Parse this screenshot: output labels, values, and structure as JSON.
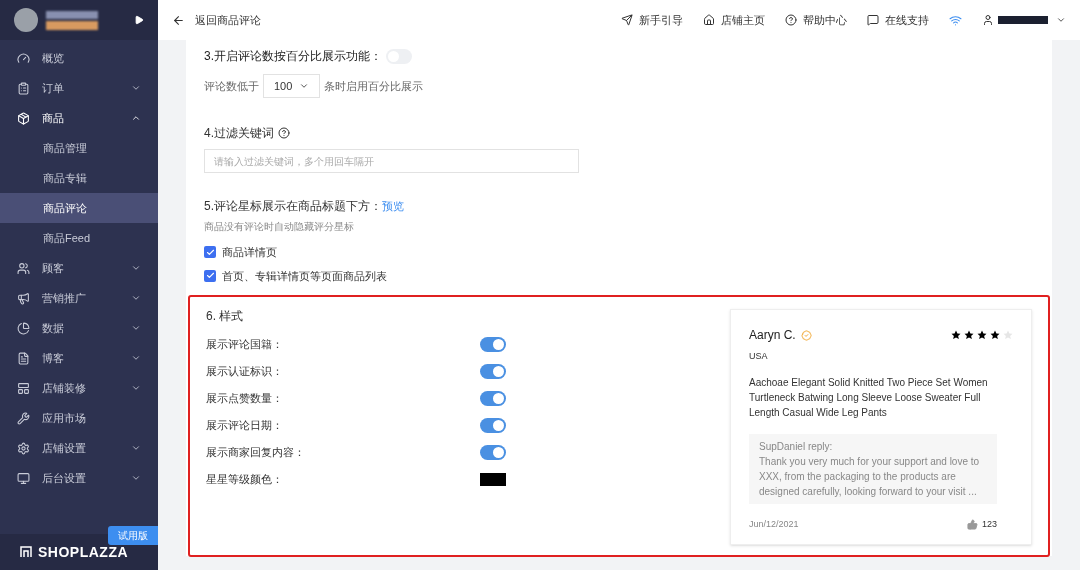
{
  "sidebar": {
    "items": [
      {
        "label": "概览"
      },
      {
        "label": "订单",
        "expanded": false
      },
      {
        "label": "商品",
        "expanded": true,
        "children": [
          {
            "label": "商品管理",
            "selected": false
          },
          {
            "label": "商品专辑",
            "selected": false
          },
          {
            "label": "商品评论",
            "selected": true
          },
          {
            "label": "商品Feed",
            "selected": false
          }
        ]
      },
      {
        "label": "顾客",
        "expanded": false
      },
      {
        "label": "营销推广",
        "expanded": false
      },
      {
        "label": "数据",
        "expanded": false
      },
      {
        "label": "博客",
        "expanded": false
      },
      {
        "label": "店铺装修",
        "expanded": false
      },
      {
        "label": "应用市场"
      },
      {
        "label": "店铺设置",
        "expanded": false
      },
      {
        "label": "后台设置",
        "expanded": false
      }
    ],
    "badge": "试用版",
    "logo": "SHOPLAZZA"
  },
  "header": {
    "back": "返回商品评论",
    "nav": [
      "新手引导",
      "店铺主页",
      "帮助中心",
      "在线支持"
    ]
  },
  "section3": {
    "title": "3.开启评论数按百分比展示功能：",
    "on": false,
    "prefix": "评论数低于",
    "select": "100",
    "suffix": "条时启用百分比展示"
  },
  "section4": {
    "title": "4.过滤关键词",
    "placeholder": "请输入过滤关键词，多个用回车隔开"
  },
  "section5": {
    "title": "5.评论星标展示在商品标题下方：",
    "link": "预览",
    "hint": "商品没有评论时自动隐藏评分星标",
    "options": [
      {
        "label": "商品详情页",
        "checked": true
      },
      {
        "label": "首页、专辑详情页等页面商品列表",
        "checked": true
      }
    ]
  },
  "section6": {
    "title": "6. 样式",
    "settings": [
      {
        "kind": "toggle",
        "label": "展示评论国籍：",
        "on": true
      },
      {
        "kind": "toggle",
        "label": "展示认证标识：",
        "on": true
      },
      {
        "kind": "toggle",
        "label": "展示点赞数量：",
        "on": true
      },
      {
        "kind": "toggle",
        "label": "展示评论日期：",
        "on": true
      },
      {
        "kind": "toggle",
        "label": "展示商家回复内容：",
        "on": true
      },
      {
        "kind": "color",
        "label": "星星等级颜色：",
        "color": "#000000"
      }
    ],
    "preview": {
      "name": "Aaryn C.",
      "stars": 4,
      "country": "USA",
      "title": "Aachoae Elegant Solid Knitted Two Piece Set Women Turtleneck Batwing Long Sleeve Loose Sweater Full Length Casual Wide Leg Pants",
      "reply_author": "SupDaniel reply:",
      "reply": "Thank you very much for your support and love to XXX, from the packaging to the products are designed carefully, looking forward to your visit ...",
      "date": "Jun/12/2021",
      "likes": "123"
    }
  }
}
